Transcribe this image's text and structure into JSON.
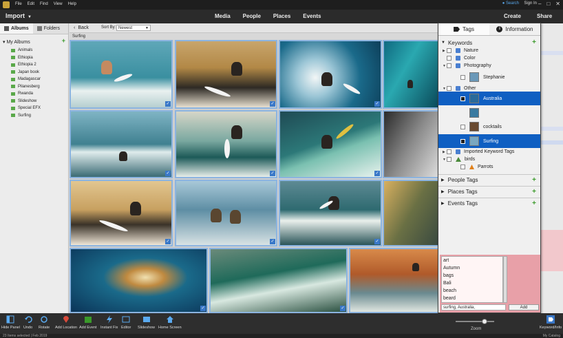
{
  "menubar": {
    "items": [
      "File",
      "Edit",
      "Find",
      "View",
      "Help"
    ],
    "search": "Search",
    "sign_in": "Sign In"
  },
  "navbar": {
    "import": "Import",
    "tabs": [
      "Media",
      "People",
      "Places",
      "Events"
    ],
    "create": "Create",
    "share": "Share"
  },
  "left_panel": {
    "tabs": [
      "Albums",
      "Folders"
    ],
    "section": "My Albums",
    "albums": [
      "Animals",
      "Ethiopia",
      "Ethiopia 2",
      "Japan book",
      "Madagascar",
      "Pilanesberg",
      "Rwanda",
      "Slideshow",
      "Special EFX",
      "Surfing"
    ]
  },
  "grid_toolbar": {
    "back": "Back",
    "sort_label": "Sort By:",
    "sort_value": "Newest",
    "breadcrumb": "Surfing"
  },
  "tags_panel": {
    "tabs": [
      "Tags",
      "Information"
    ],
    "keywords_label": "Keywords",
    "tags": [
      "Nature",
      "Color",
      "Photography",
      "Stephanie",
      "Other",
      "Australia",
      "cocktails",
      "Surfing",
      "Imported Keyword Tags",
      "birds",
      "Parrots"
    ],
    "sections": [
      "People Tags",
      "Places Tags",
      "Events Tags"
    ],
    "suggestions": [
      "art",
      "Autumn",
      "bags",
      "Bali",
      "beach",
      "beard"
    ],
    "input_value": "surfing, Australia,",
    "add_button": "Add"
  },
  "zoom": {
    "label": "Zoom",
    "level": 0.7
  },
  "bottom_toolbar": {
    "tools": [
      "Hide Panel",
      "Undo",
      "Rotate",
      "Add Location",
      "Add Event",
      "Instant Fix",
      "Editor",
      "Slideshow",
      "Home Screen"
    ],
    "keyword_info": "Keyword/Info"
  },
  "status": {
    "selection": "23 Items selected | Feb 2019",
    "catalog": "My Catalog"
  },
  "colors": {
    "accent": "#0f5fc2",
    "selection_border": "#8cb4e0",
    "add_green": "#3a9a2a",
    "highlight_pink": "#e8a0a8"
  }
}
